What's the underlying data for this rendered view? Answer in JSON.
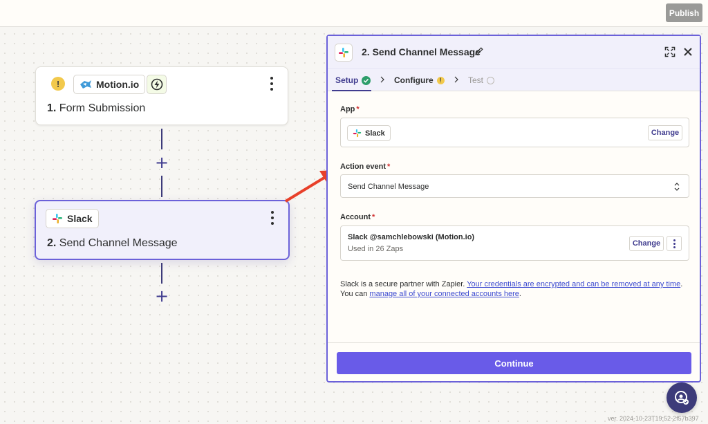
{
  "topbar": {
    "publish_label": "Publish"
  },
  "canvas": {
    "step1": {
      "app_name": "Motion.io",
      "number": "1.",
      "title": "Form Submission"
    },
    "step2": {
      "app_name": "Slack",
      "number": "2.",
      "title": "Send Channel Message"
    }
  },
  "panel": {
    "title": "2. Send Channel Message",
    "tabs": [
      {
        "label": "Setup",
        "status": "complete"
      },
      {
        "label": "Configure",
        "status": "warning"
      },
      {
        "label": "Test",
        "status": "pending"
      }
    ],
    "app_field": {
      "label": "App",
      "value": "Slack",
      "change_label": "Change"
    },
    "action_field": {
      "label": "Action event",
      "value": "Send Channel Message"
    },
    "account_field": {
      "label": "Account",
      "name": "Slack @samchlebowski (Motion.io)",
      "usage": "Used in 26 Zaps",
      "change_label": "Change"
    },
    "partner_notice": {
      "prefix": "Slack is a secure partner with Zapier. ",
      "link1": "Your credentials are encrypted and can be removed at any time",
      "middle": ". You can ",
      "link2": "manage all of your connected accounts here",
      "suffix": "."
    },
    "continue_label": "Continue"
  },
  "required_marker": "*",
  "warning_glyph": "!",
  "plus_glyph": "+",
  "version": "ver. 2024-10-23T19:52-2f57b397",
  "colors": {
    "accent": "#695be8",
    "selected_border": "#6b61d9",
    "success": "#2e9e6b",
    "warning": "#f2c94c",
    "annotation_arrow": "#e8402a"
  },
  "icons": {
    "step1_app": "motion-logo-icon",
    "step1_trigger": "lightning-icon",
    "slack": "slack-logo-icon"
  }
}
